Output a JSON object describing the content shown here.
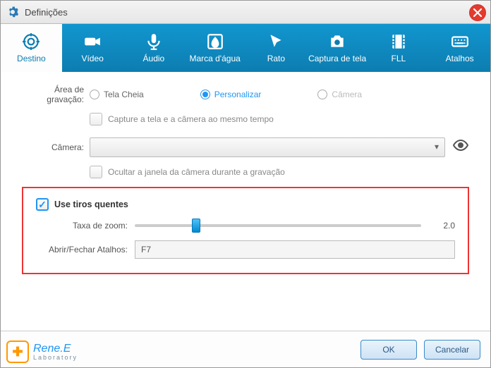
{
  "window": {
    "title": "Definições"
  },
  "tabs": [
    {
      "label": "Destino"
    },
    {
      "label": "Vídeo"
    },
    {
      "label": "Áudio"
    },
    {
      "label": "Marca d'água"
    },
    {
      "label": "Rato"
    },
    {
      "label": "Captura de tela"
    },
    {
      "label": "FLL"
    },
    {
      "label": "Atalhos"
    }
  ],
  "recording": {
    "label": "Área de gravação:",
    "radios": {
      "fullscreen": "Tela Cheia",
      "custom": "Personalizar",
      "camera": "Câmera"
    },
    "capture_both": "Capture a tela e a câmera ao mesmo tempo"
  },
  "camera": {
    "label": "Câmera:",
    "hide_label": "Ocultar a janela da câmera durante a gravação"
  },
  "hotshot": {
    "checkbox_label": "Use tiros quentes",
    "zoom_label": "Taxa de zoom:",
    "zoom_value": "2.0",
    "zoom_thumb_percent": 20,
    "hotkey_label": "Abrir/Fechar Atalhos:",
    "hotkey_value": "F7"
  },
  "footer": {
    "brand": "Rene.E",
    "brand_sub": "Laboratory",
    "ok": "OK",
    "cancel": "Cancelar"
  }
}
